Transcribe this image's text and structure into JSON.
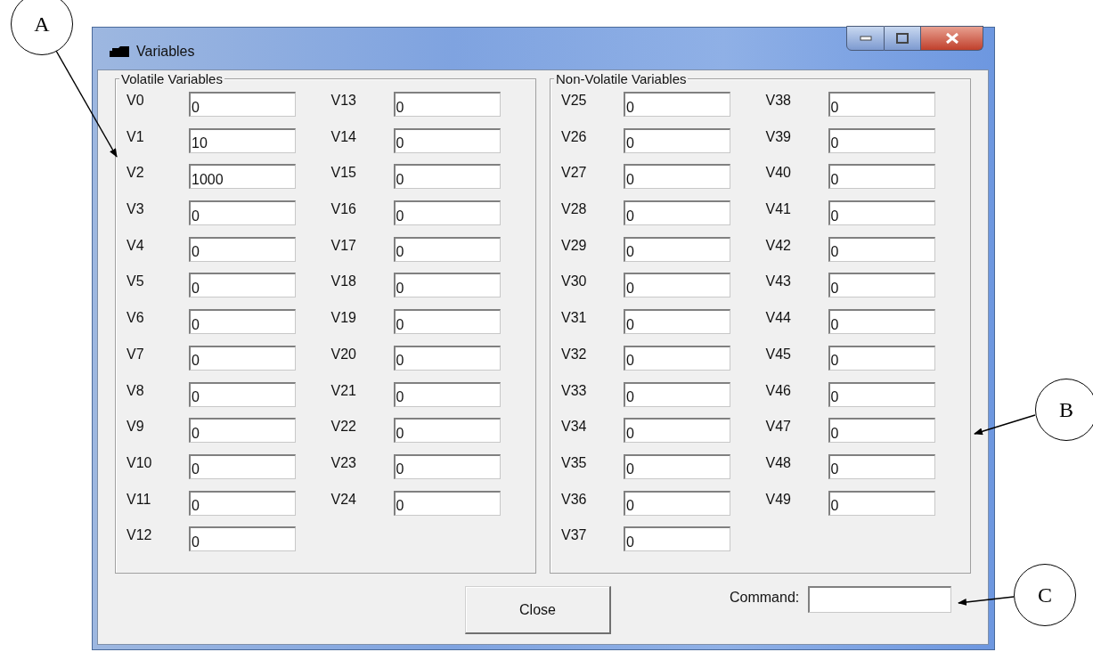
{
  "window": {
    "title": "Variables"
  },
  "groups": [
    {
      "title": "Volatile Variables",
      "columns": [
        [
          {
            "label": "V0",
            "value": "0"
          },
          {
            "label": "V1",
            "value": "10"
          },
          {
            "label": "V2",
            "value": "1000"
          },
          {
            "label": "V3",
            "value": "0"
          },
          {
            "label": "V4",
            "value": "0"
          },
          {
            "label": "V5",
            "value": "0"
          },
          {
            "label": "V6",
            "value": "0"
          },
          {
            "label": "V7",
            "value": "0"
          },
          {
            "label": "V8",
            "value": "0"
          },
          {
            "label": "V9",
            "value": "0"
          },
          {
            "label": "V10",
            "value": "0"
          },
          {
            "label": "V11",
            "value": "0"
          },
          {
            "label": "V12",
            "value": "0"
          }
        ],
        [
          {
            "label": "V13",
            "value": "0"
          },
          {
            "label": "V14",
            "value": "0"
          },
          {
            "label": "V15",
            "value": "0"
          },
          {
            "label": "V16",
            "value": "0"
          },
          {
            "label": "V17",
            "value": "0"
          },
          {
            "label": "V18",
            "value": "0"
          },
          {
            "label": "V19",
            "value": "0"
          },
          {
            "label": "V20",
            "value": "0"
          },
          {
            "label": "V21",
            "value": "0"
          },
          {
            "label": "V22",
            "value": "0"
          },
          {
            "label": "V23",
            "value": "0"
          },
          {
            "label": "V24",
            "value": "0"
          }
        ]
      ]
    },
    {
      "title": "Non-Volatile Variables",
      "columns": [
        [
          {
            "label": "V25",
            "value": "0"
          },
          {
            "label": "V26",
            "value": "0"
          },
          {
            "label": "V27",
            "value": "0"
          },
          {
            "label": "V28",
            "value": "0"
          },
          {
            "label": "V29",
            "value": "0"
          },
          {
            "label": "V30",
            "value": "0"
          },
          {
            "label": "V31",
            "value": "0"
          },
          {
            "label": "V32",
            "value": "0"
          },
          {
            "label": "V33",
            "value": "0"
          },
          {
            "label": "V34",
            "value": "0"
          },
          {
            "label": "V35",
            "value": "0"
          },
          {
            "label": "V36",
            "value": "0"
          },
          {
            "label": "V37",
            "value": "0"
          }
        ],
        [
          {
            "label": "V38",
            "value": "0"
          },
          {
            "label": "V39",
            "value": "0"
          },
          {
            "label": "V40",
            "value": "0"
          },
          {
            "label": "V41",
            "value": "0"
          },
          {
            "label": "V42",
            "value": "0"
          },
          {
            "label": "V43",
            "value": "0"
          },
          {
            "label": "V44",
            "value": "0"
          },
          {
            "label": "V45",
            "value": "0"
          },
          {
            "label": "V46",
            "value": "0"
          },
          {
            "label": "V47",
            "value": "0"
          },
          {
            "label": "V48",
            "value": "0"
          },
          {
            "label": "V49",
            "value": "0"
          }
        ]
      ]
    }
  ],
  "close_button": "Close",
  "command": {
    "label": "Command:"
  },
  "callouts": [
    {
      "label": "A"
    },
    {
      "label": "B"
    },
    {
      "label": "C"
    }
  ]
}
